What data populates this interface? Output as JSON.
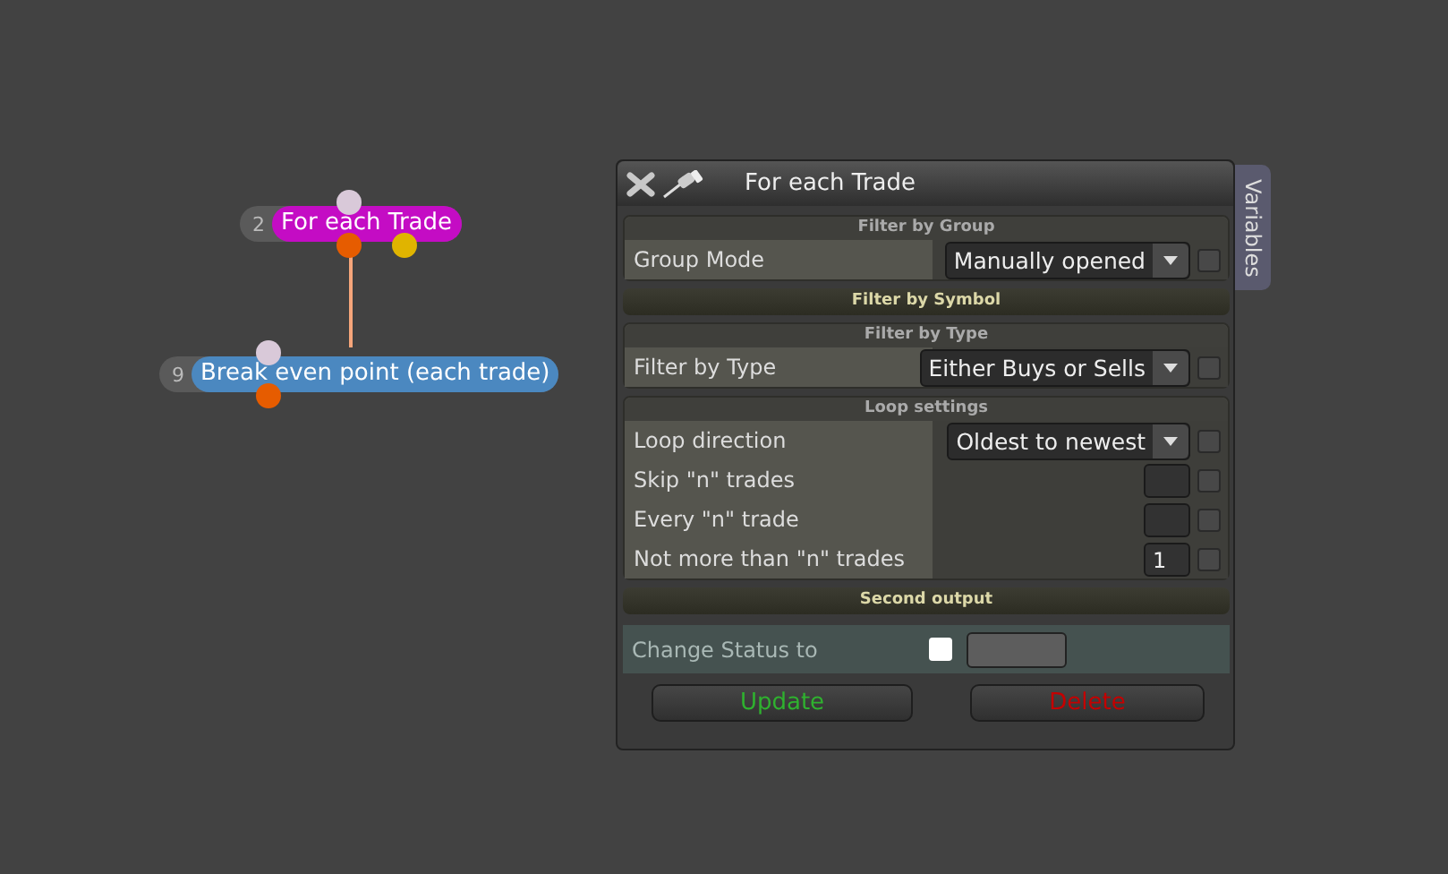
{
  "nodes": [
    {
      "number": "2",
      "label": "For each Trade",
      "color": "#c40cc4"
    },
    {
      "number": "9",
      "label": "Break even point (each trade)",
      "color": "#4b88c0"
    }
  ],
  "panel": {
    "title": "For each Trade",
    "side_tab": "Variables",
    "sections": [
      {
        "kind": "group",
        "title": "Filter by Group",
        "rows": [
          {
            "kind": "select",
            "label": "Group Mode",
            "value": "Manually opened",
            "checked": false
          }
        ]
      },
      {
        "kind": "bar",
        "title": "Filter by Symbol"
      },
      {
        "kind": "group",
        "title": "Filter by Type",
        "rows": [
          {
            "kind": "select",
            "label": "Filter by Type",
            "value": "Either Buys or Sells",
            "checked": false
          }
        ]
      },
      {
        "kind": "group",
        "title": "Loop settings",
        "rows": [
          {
            "kind": "select",
            "label": "Loop direction",
            "value": "Oldest to newest",
            "checked": false
          },
          {
            "kind": "number",
            "label": "Skip \"n\" trades",
            "checked": false
          },
          {
            "kind": "number",
            "label": "Every \"n\" trade",
            "checked": false
          },
          {
            "kind": "number",
            "label": "Not more than \"n\" trades",
            "value": "1",
            "checked": false
          }
        ]
      },
      {
        "kind": "bar",
        "title": "Second output",
        "rows": [
          {
            "kind": "status",
            "label": "Change Status to",
            "checked": false
          }
        ]
      }
    ],
    "buttons": [
      {
        "label": "Update",
        "color": "#2fb12f"
      },
      {
        "label": "Delete",
        "color": "#c40000"
      }
    ]
  }
}
